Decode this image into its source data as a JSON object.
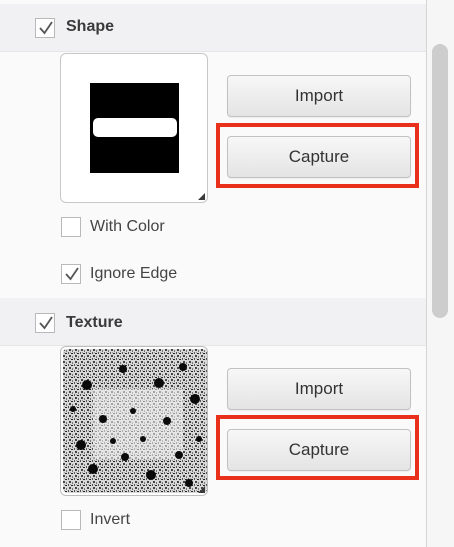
{
  "shape": {
    "label": "Shape",
    "checked": true,
    "import_label": "Import",
    "capture_label": "Capture",
    "with_color_label": "With Color",
    "with_color_checked": false,
    "ignore_edge_label": "Ignore Edge",
    "ignore_edge_checked": true
  },
  "texture": {
    "label": "Texture",
    "checked": true,
    "import_label": "Import",
    "capture_label": "Capture",
    "invert_label": "Invert",
    "invert_checked": false
  },
  "colors": {
    "highlight": "#e8301a",
    "header_bg": "#f1f1f3"
  }
}
